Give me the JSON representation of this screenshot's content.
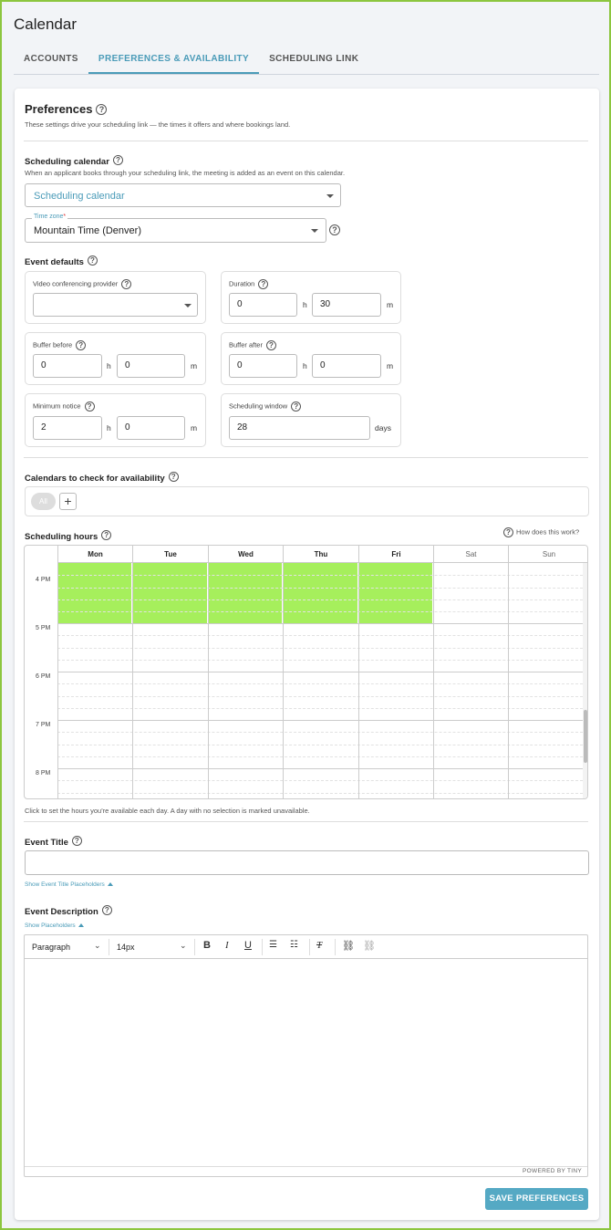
{
  "page": {
    "title": "Calendar"
  },
  "tabs": [
    {
      "label": "ACCOUNTS",
      "active": false
    },
    {
      "label": "PREFERENCES & AVAILABILITY",
      "active": true
    },
    {
      "label": "SCHEDULING LINK",
      "active": false
    }
  ],
  "preferences": {
    "title": "Preferences",
    "description": "These settings drive your scheduling link — the times it offers and where bookings land."
  },
  "scheduling_calendar": {
    "title": "Scheduling calendar",
    "description": "When an applicant books through your scheduling link, the meeting is added as an event on this calendar.",
    "select_placeholder": "Scheduling calendar"
  },
  "timezone": {
    "label": "Time zone",
    "required_mark": "*",
    "value": "Mountain Time (Denver)"
  },
  "event_defaults": {
    "title": "Event defaults",
    "video": {
      "label": "Video conferencing provider",
      "value": ""
    },
    "duration": {
      "label": "Duration",
      "hours": "0",
      "minutes": "30"
    },
    "buffer_before": {
      "label": "Buffer before",
      "hours": "0",
      "minutes": "0"
    },
    "buffer_after": {
      "label": "Buffer after",
      "hours": "0",
      "minutes": "0"
    },
    "minimum_notice": {
      "label": "Minimum notice",
      "hours": "2",
      "minutes": "0"
    },
    "scheduling_window": {
      "label": "Scheduling window",
      "value": "28",
      "unit": "days"
    },
    "unit_h": "h",
    "unit_m": "m"
  },
  "calendars_check": {
    "title": "Calendars to check for availability",
    "chip": "All",
    "add": "+"
  },
  "scheduling_hours": {
    "title": "Scheduling hours",
    "help_link": "How does this work?",
    "days": [
      "Mon",
      "Tue",
      "Wed",
      "Thu",
      "Fri",
      "Sat",
      "Sun"
    ],
    "hours": [
      "4 PM",
      "5 PM",
      "6 PM",
      "7 PM",
      "8 PM"
    ],
    "hint": "Click to set the hours you're available each day. A day with no selection is marked unavailable."
  },
  "event_title": {
    "title": "Event Title",
    "value": "",
    "placeholders_link": "Show Event Title Placeholders"
  },
  "event_description": {
    "title": "Event Description",
    "placeholders_link": "Show Placeholders",
    "block_format": "Paragraph",
    "font_size": "14px",
    "powered_by": "POWERED BY TINY"
  },
  "actions": {
    "save": "SAVE PREFERENCES"
  },
  "colors": {
    "accent": "#4a9bb8",
    "available": "#a6ef5c",
    "border": "#8cc63f"
  }
}
